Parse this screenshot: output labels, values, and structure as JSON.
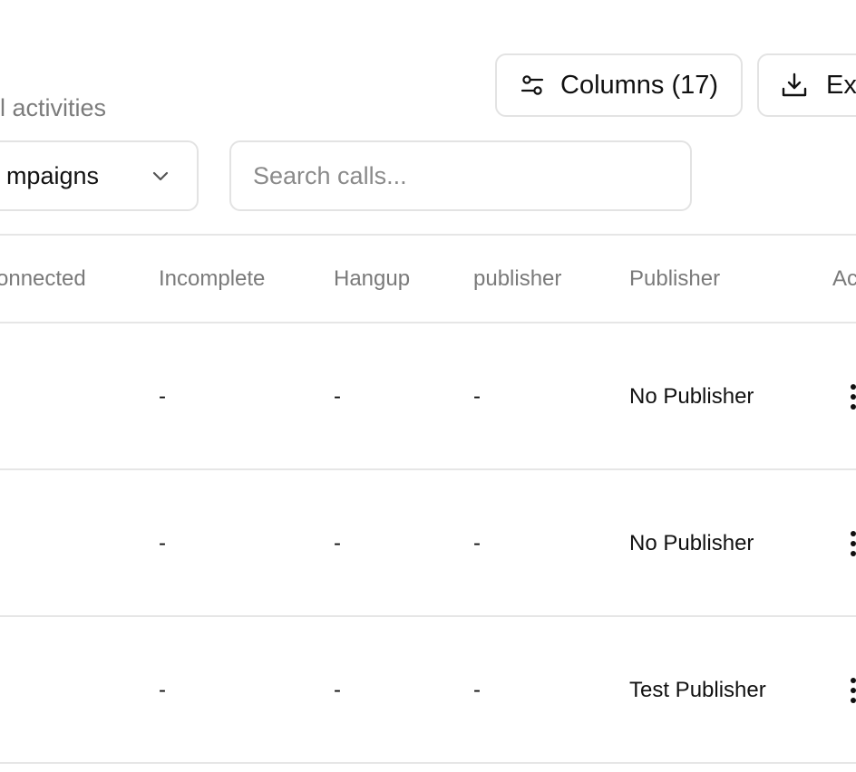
{
  "header": {
    "subtitle": "ll activities",
    "columns_button_label": "Columns (17)",
    "export_button_label": "Ex"
  },
  "filters": {
    "campaign_select_value": "mpaigns",
    "search_placeholder": "Search calls..."
  },
  "table": {
    "columns": [
      "onnected",
      "Incomplete",
      "Hangup",
      "publisher",
      "Publisher",
      "Ac"
    ],
    "rows": [
      {
        "incomplete": "-",
        "hangup": "-",
        "publisher_id": "-",
        "publisher": "No Publisher"
      },
      {
        "incomplete": "-",
        "hangup": "-",
        "publisher_id": "-",
        "publisher": "No Publisher"
      },
      {
        "incomplete": "-",
        "hangup": "-",
        "publisher_id": "-",
        "publisher": "Test Publisher"
      }
    ]
  },
  "icons": {
    "columns": "sliders-icon",
    "export": "download-icon",
    "select": "chevron-down-icon",
    "row_actions": "more-vertical-icon"
  }
}
